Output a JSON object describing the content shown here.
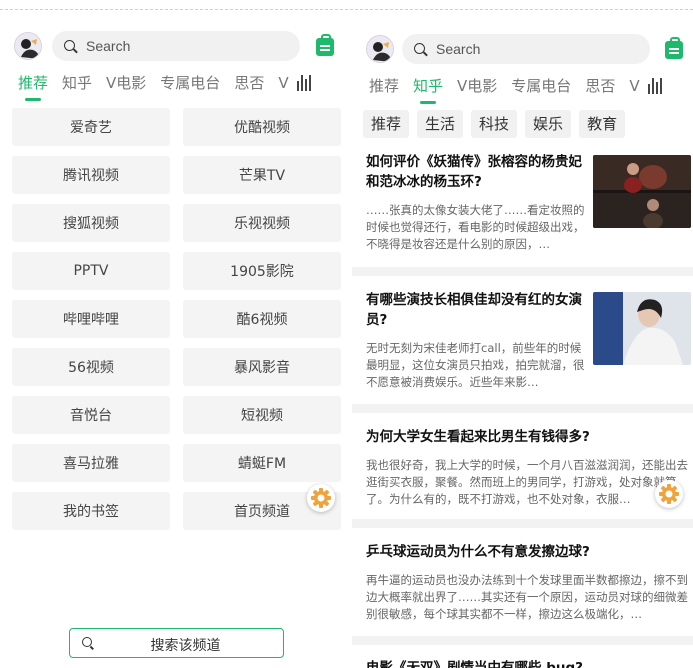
{
  "left": {
    "search_placeholder": "Search",
    "tabs": [
      "推荐",
      "知乎",
      "V电影",
      "专属电台",
      "思否",
      "V"
    ],
    "active_tab": 0,
    "channels": [
      "爱奇艺",
      "优酷视频",
      "腾讯视频",
      "芒果TV",
      "搜狐视频",
      "乐视视频",
      "PPTV",
      "1905影院",
      "哔哩哔哩",
      "酷6视频",
      "56视频",
      "暴风影音",
      "音悦台",
      "短视频",
      "喜马拉雅",
      "蜻蜓FM",
      "我的书签",
      "首页频道"
    ],
    "bottom_search": "搜索该频道"
  },
  "right": {
    "search_placeholder": "Search",
    "tabs": [
      "推荐",
      "知乎",
      "V电影",
      "专属电台",
      "思否",
      "V"
    ],
    "active_tab": 1,
    "chips": [
      "推荐",
      "生活",
      "科技",
      "娱乐",
      "教育"
    ],
    "articles": [
      {
        "title": "如何评价《妖猫传》张榕容的杨贵妃和范冰冰的杨玉环?",
        "body": "……张真的太像女装大佬了……看定妆照的时候也觉得还行，看电影的时候超级出戏，不晓得是妆容还是什么别的原因，…"
      },
      {
        "title": "有哪些演技长相俱佳却没有红的女演员?",
        "body": "无时无刻为宋佳老师打call，前些年的时候最明显，这位女演员只拍戏，拍完就溜，很不愿意被消费娱乐。近些年来影…"
      },
      {
        "title": "为何大学女生看起来比男生有钱得多?",
        "body": "我也很好奇，我上大学的时候，一个月八百滋滋润润，还能出去逛街买衣服，聚餐。然而班上的男同学，打游戏，处对象就算了。为什么有的，既不打游戏，也不处对象，衣服…"
      },
      {
        "title": "乒乓球运动员为什么不有意发擦边球?",
        "body": "再牛逼的运动员也没办法练到十个发球里面半数都擦边，擦不到边大概率就出界了……其实还有一个原因，运动员对球的细微差别很敏感，每个球其实都不一样，擦边这么极端化，…"
      },
      {
        "title": "电影《无双》剧情当中有哪些 bug?",
        "body": ""
      }
    ]
  },
  "colors": {
    "accent": "#1fb96b"
  },
  "icons": {
    "avatar": "avatar-icon",
    "search": "search-icon",
    "bag": "shopping-bag-icon",
    "bars": "voice-bars-icon",
    "gear": "gear-icon"
  }
}
